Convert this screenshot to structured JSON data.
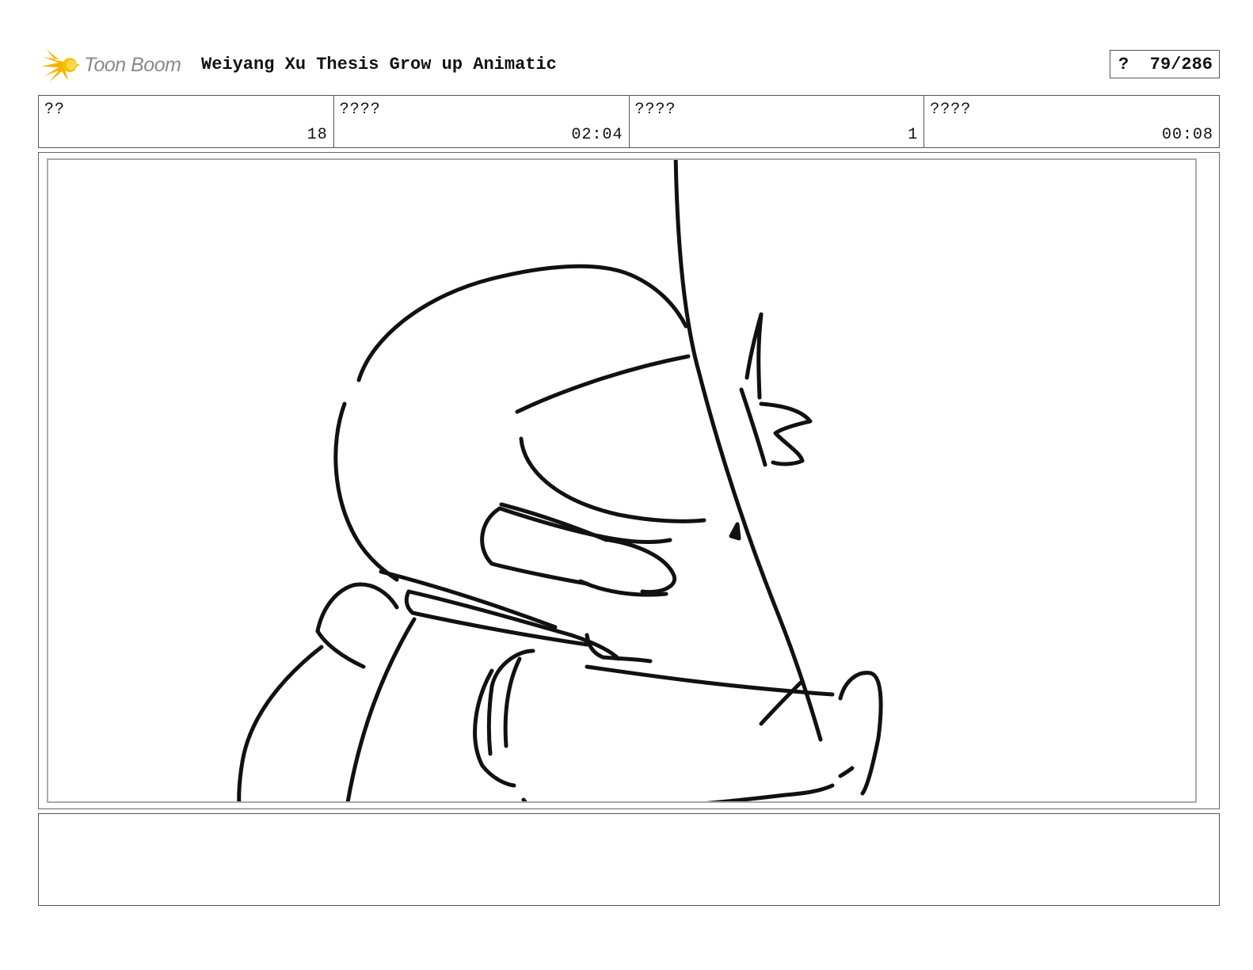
{
  "header": {
    "logo_text": "Toon Boom",
    "title": "Weiyang Xu Thesis Grow up Animatic",
    "page_symbol": "?",
    "page_counter": "79/286"
  },
  "info": [
    {
      "label": "??",
      "value": "18"
    },
    {
      "label": "????",
      "value": "02:04"
    },
    {
      "label": "????",
      "value": "1"
    },
    {
      "label": "????",
      "value": "00:08"
    }
  ],
  "notes": {
    "text": ""
  },
  "colors": {
    "logo_accent": "#f5b400",
    "logo_text": "#8a8a8a",
    "ink": "#111111"
  }
}
